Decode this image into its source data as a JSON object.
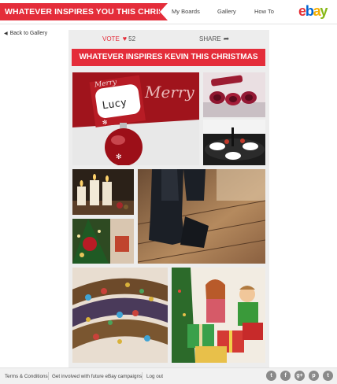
{
  "header": {
    "banner": "WHATEVER INSPIRES YOU THIS CHRISTMAS",
    "nav": [
      "My Boards",
      "Gallery",
      "How To"
    ],
    "logo": {
      "e": "e",
      "b": "b",
      "a": "a",
      "y": "y"
    }
  },
  "back_link": "Back to Gallery",
  "board": {
    "vote_label": "VOTE",
    "vote_count": "52",
    "share_label": "SHARE",
    "title": "WHATEVER INSPIRES KEVIN THIS CHRISTMAS",
    "place_card_name": "Lucy",
    "place_card_word": "Merry"
  },
  "footer": {
    "links": [
      "Terms & Conditions",
      "Get involved with future eBay campaigns",
      "Log out"
    ],
    "social": [
      "twitter-icon",
      "facebook-icon",
      "google-plus-icon",
      "pinterest-icon",
      "tumblr-icon"
    ],
    "social_glyphs": [
      "t",
      "f",
      "g+",
      "p",
      "t"
    ]
  },
  "colors": {
    "accent": "#e42d3a",
    "board_bg": "#ededed"
  }
}
